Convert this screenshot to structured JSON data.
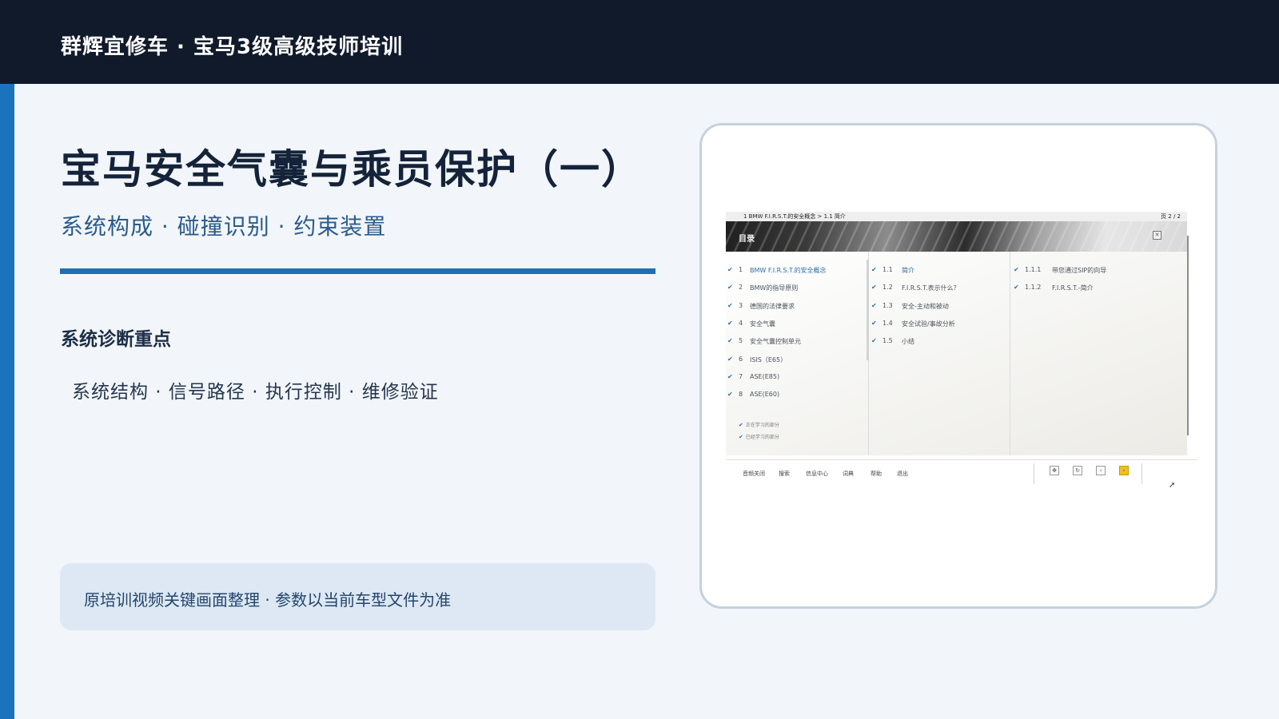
{
  "header": {
    "title": "群辉宜修车 · 宝马3级高级技师培训"
  },
  "slide": {
    "title": "宝马安全气囊与乘员保护（一）",
    "subtitle": "系统构成 · 碰撞识别 · 约束装置",
    "section_heading": "系统诊断重点",
    "section_items": "系统结构 · 信号路径 · 执行控制 · 维修验证",
    "note": "原培训视频关键画面整理 · 参数以当前车型文件为准"
  },
  "screenshot": {
    "breadcrumb": "1 BMW F.I.R.S.T.的安全概念 > 1.1 简介",
    "page": "页  2 / 2",
    "banner_label": "目录",
    "chapters": [
      {
        "num": "1",
        "label": "BMW F.I.R.S.T.的安全概念",
        "check": "✔",
        "active": true
      },
      {
        "num": "2",
        "label": "BMW的指导原则",
        "check": "✔"
      },
      {
        "num": "3",
        "label": "德国的法律要求",
        "check": "✔"
      },
      {
        "num": "4",
        "label": "安全气囊",
        "check": "✔"
      },
      {
        "num": "5",
        "label": "安全气囊控制单元",
        "check": "✔"
      },
      {
        "num": "6",
        "label": "ISIS（E65）",
        "check": "✔"
      },
      {
        "num": "7",
        "label": "ASE(E85)",
        "check": "✔"
      },
      {
        "num": "8",
        "label": "ASE(E60)",
        "check": "✔"
      }
    ],
    "sections": [
      {
        "num": "1.1",
        "label": "简介",
        "check": "✔",
        "active": true
      },
      {
        "num": "1.2",
        "label": "F.I.R.S.T.表示什么？",
        "check": "✔"
      },
      {
        "num": "1.3",
        "label": "安全-主动和被动",
        "check": "✔"
      },
      {
        "num": "1.4",
        "label": "安全试验/事故分析",
        "check": "✔"
      },
      {
        "num": "1.5",
        "label": "小结",
        "check": "✔"
      }
    ],
    "subsections": [
      {
        "num": "1.1.1",
        "label": "带您通过SIP的向导",
        "check": "✔"
      },
      {
        "num": "1.1.2",
        "label": "F.I.R.S.T.-简介",
        "check": "✔"
      }
    ],
    "legend": [
      {
        "check": "✔",
        "label": "正在学习的部分"
      },
      {
        "check": "✔",
        "label": "已经学习的部分"
      }
    ],
    "footer_links": [
      "音频关闭",
      "搜索",
      "信息中心",
      "词典",
      "帮助",
      "退出"
    ],
    "nav_icons": [
      "overview-icon",
      "refresh-icon",
      "previous-icon",
      "next-icon"
    ],
    "nav_glyphs": [
      "✥",
      "↻",
      "‹",
      "›"
    ]
  },
  "colors": {
    "topbar": "#111a2b",
    "accent": "#1b73bd",
    "divider": "#1f6fb3",
    "note_bg": "#dde8f4",
    "next_button": "#f1c21b"
  }
}
